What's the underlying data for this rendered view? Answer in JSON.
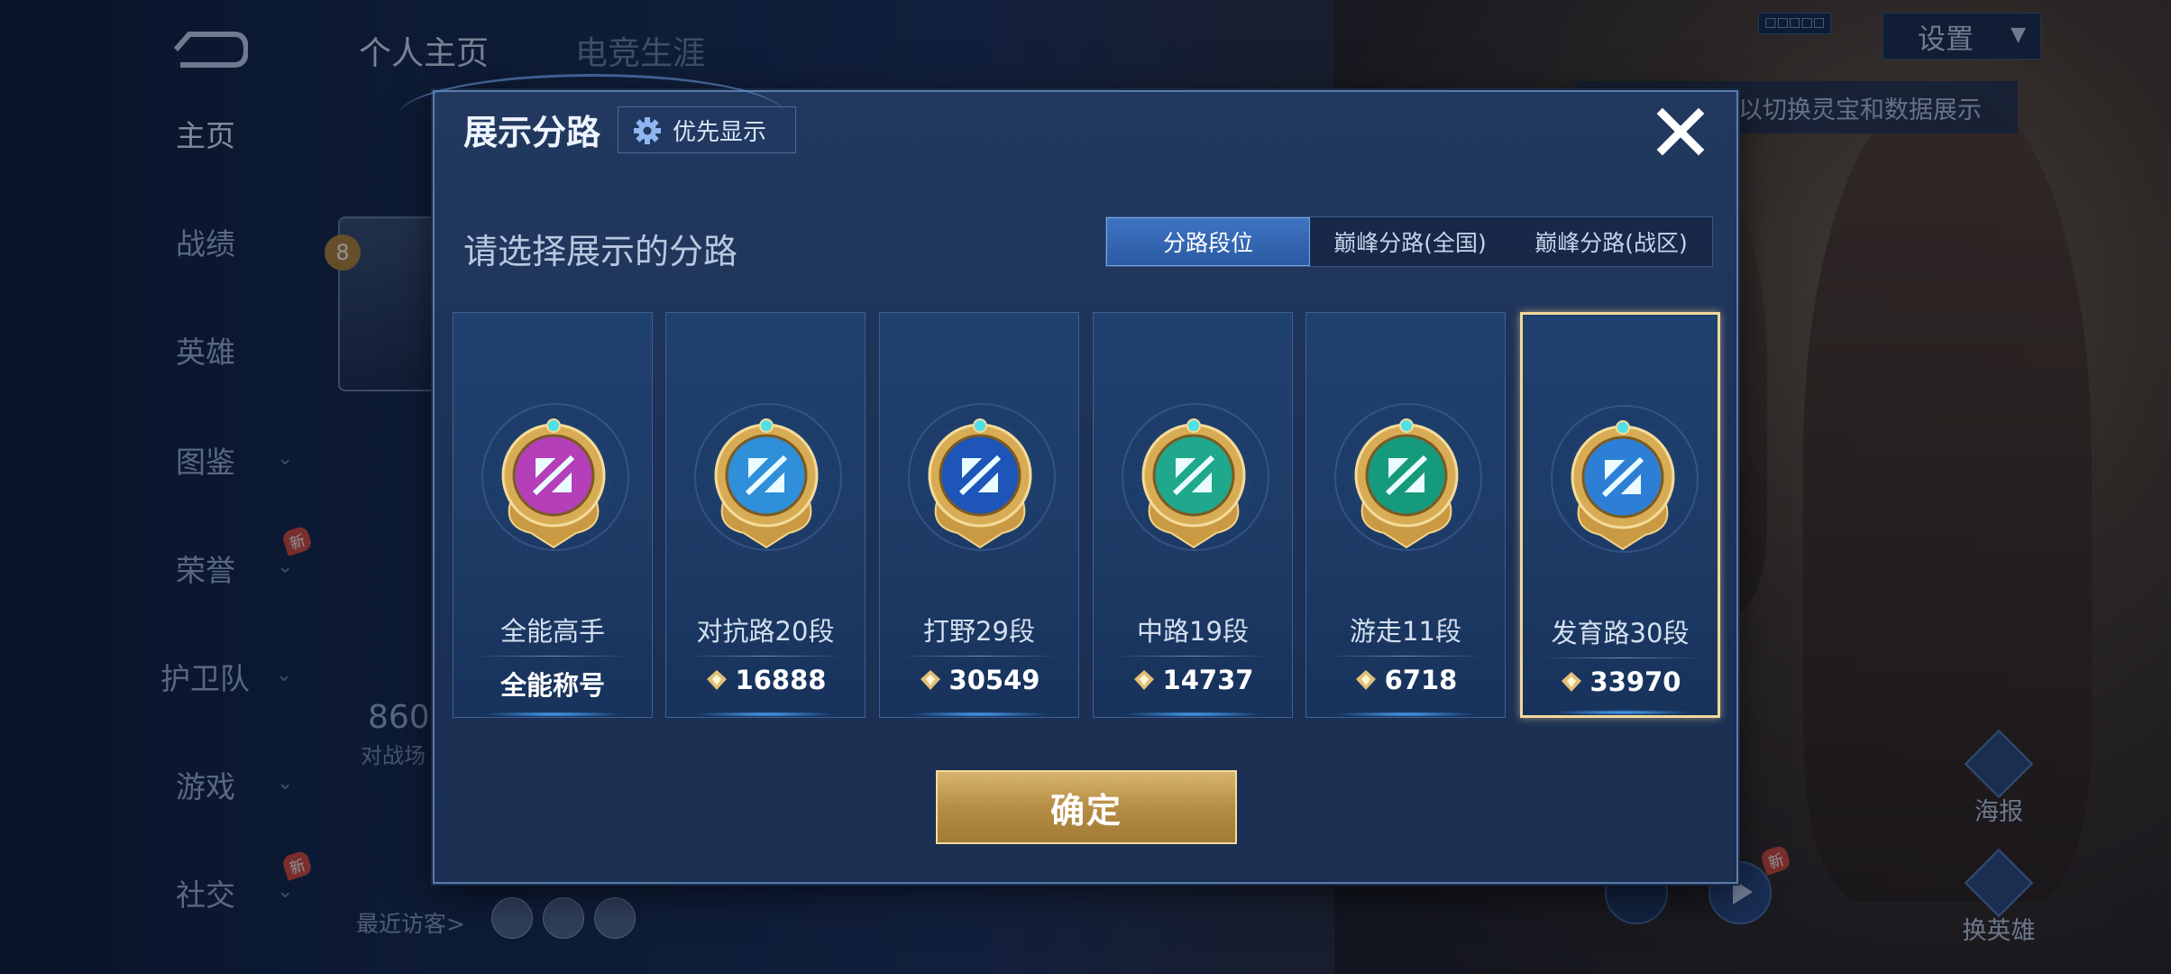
{
  "sidebar": {
    "items": [
      {
        "label": "主页",
        "active": true,
        "chevron": false,
        "new": false
      },
      {
        "label": "战绩",
        "active": false,
        "chevron": false,
        "new": false
      },
      {
        "label": "英雄",
        "active": false,
        "chevron": false,
        "new": false
      },
      {
        "label": "图鉴",
        "active": false,
        "chevron": true,
        "new": false
      },
      {
        "label": "荣誉",
        "active": false,
        "chevron": true,
        "new": true
      },
      {
        "label": "护卫队",
        "active": false,
        "chevron": true,
        "new": false
      },
      {
        "label": "游戏",
        "active": false,
        "chevron": true,
        "new": false
      },
      {
        "label": "社交",
        "active": false,
        "chevron": true,
        "new": true
      }
    ],
    "new_badge": "新"
  },
  "top_tabs": {
    "personal": "个人主页",
    "esports": "电竞生涯"
  },
  "settings": {
    "label": "设置"
  },
  "hint_text": "以切换灵宝和数据展示",
  "profile": {
    "level": "8",
    "stat_number": "860",
    "stat_label": "对战场",
    "visitors_label": "最近访客>"
  },
  "right_buttons": {
    "poster": "海报",
    "change_hero": "换英雄",
    "new_badge": "新"
  },
  "modal": {
    "title": "展示分路",
    "priority_button": "优先显示",
    "prompt": "请选择展示的分路",
    "segments": [
      {
        "label": "分路段位",
        "selected": true
      },
      {
        "label": "巅峰分路(全国)",
        "selected": false
      },
      {
        "label": "巅峰分路(战区)",
        "selected": false
      }
    ],
    "cards": [
      {
        "name": "全能高手",
        "score": "全能称号",
        "show_coin": false,
        "medal_color": "#b43fb8",
        "selected": false
      },
      {
        "name": "对抗路20段",
        "score": "16888",
        "show_coin": true,
        "medal_color": "#2f8fd8",
        "selected": false
      },
      {
        "name": "打野29段",
        "score": "30549",
        "show_coin": true,
        "medal_color": "#1d55b8",
        "selected": false
      },
      {
        "name": "中路19段",
        "score": "14737",
        "show_coin": true,
        "medal_color": "#1fa88c",
        "selected": false
      },
      {
        "name": "游走11段",
        "score": "6718",
        "show_coin": true,
        "medal_color": "#169a7c",
        "selected": false
      },
      {
        "name": "发育路30段",
        "score": "33970",
        "show_coin": true,
        "medal_color": "#2d7fd6",
        "selected": true
      }
    ],
    "confirm_label": "确定"
  }
}
